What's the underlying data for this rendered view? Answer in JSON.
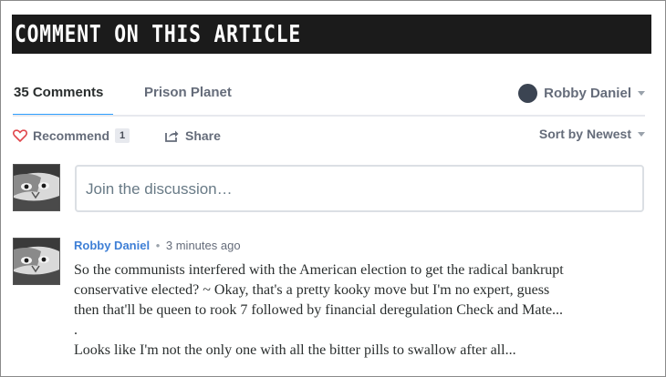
{
  "banner": {
    "title": "COMMENT ON THIS ARTICLE"
  },
  "nav": {
    "comments_tab": "35 Comments",
    "site_tab": "Prison Planet",
    "user_name": "Robby Daniel"
  },
  "actions": {
    "recommend_label": "Recommend",
    "recommend_count": "1",
    "share_label": "Share",
    "sort_label": "Sort by Newest"
  },
  "compose": {
    "placeholder": "Join the discussion…"
  },
  "comment": {
    "author": "Robby Daniel",
    "separator": "•",
    "time": "3 minutes ago",
    "lines": [
      "So the communists interfered with the American election to get the radical bankrupt",
      "conservative elected? ~ Okay, that's a pretty kooky move but I'm no expert, guess",
      "then that'll be queen to rook 7 followed by financial deregulation Check and Mate...",
      ".",
      "Looks like I'm not the only one with all the bitter pills to swallow after all..."
    ]
  },
  "colors": {
    "accent": "#2e9fff",
    "banner_bg": "#1b1b1b",
    "heart": "#e0474c"
  },
  "icons": [
    "heart-icon",
    "share-icon",
    "chevron-down-icon",
    "user-avatar-icon"
  ]
}
